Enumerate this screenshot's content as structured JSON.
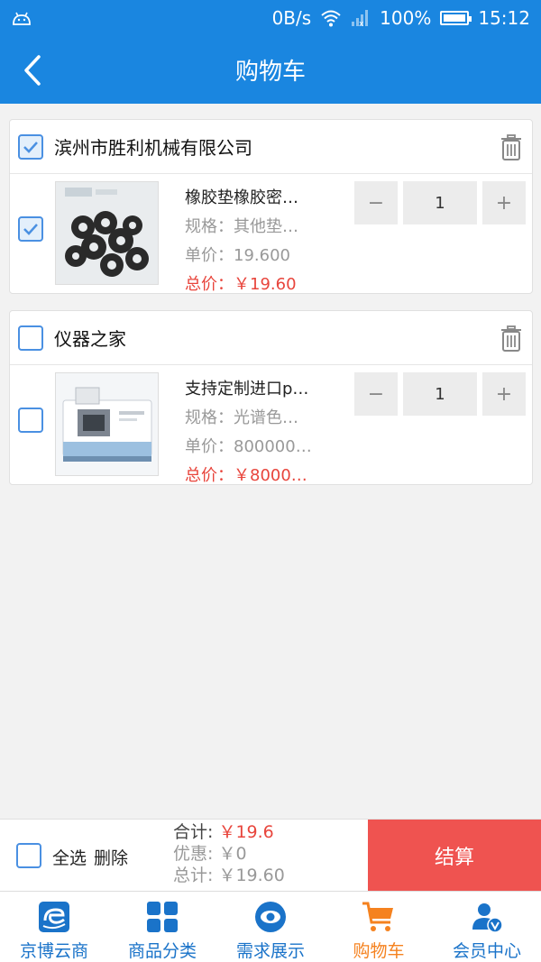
{
  "status_bar": {
    "net_speed": "0B/s",
    "battery": "100%",
    "time": "15:12"
  },
  "header": {
    "title": "购物车"
  },
  "stores": [
    {
      "name": "滨州市胜利机械有限公司",
      "checked": true,
      "item": {
        "name": "橡胶垫橡胶密…",
        "spec": "规格：其他垫…",
        "price": "单价：19.600",
        "total": "总价：￥19.60",
        "qty": "1",
        "checked": true
      }
    },
    {
      "name": "仪器之家",
      "checked": false,
      "item": {
        "name": "支持定制进口p…",
        "spec": "规格：光谱色…",
        "price": "单价：800000…",
        "total": "总价：￥8000…",
        "qty": "1",
        "checked": false
      }
    }
  ],
  "stepper": {
    "minus": "−",
    "plus": "+"
  },
  "checkout": {
    "select_all": "全选",
    "delete": "删除",
    "sum_label": "合计:",
    "sum_value": "￥19.6",
    "discount_label": "优惠:",
    "discount_value": "￥0",
    "total_label": "总计:",
    "total_value": "￥19.60",
    "pay": "结算"
  },
  "tabs": [
    {
      "label": "京博云商",
      "icon": "logo-icon"
    },
    {
      "label": "商品分类",
      "icon": "grid-icon"
    },
    {
      "label": "需求展示",
      "icon": "eye-icon"
    },
    {
      "label": "购物车",
      "icon": "cart-icon",
      "active": true
    },
    {
      "label": "会员中心",
      "icon": "member-icon"
    }
  ],
  "colors": {
    "primary": "#1a86e0",
    "accent": "#ef5350",
    "price": "#e8453c",
    "active_tab": "#f5821f"
  }
}
